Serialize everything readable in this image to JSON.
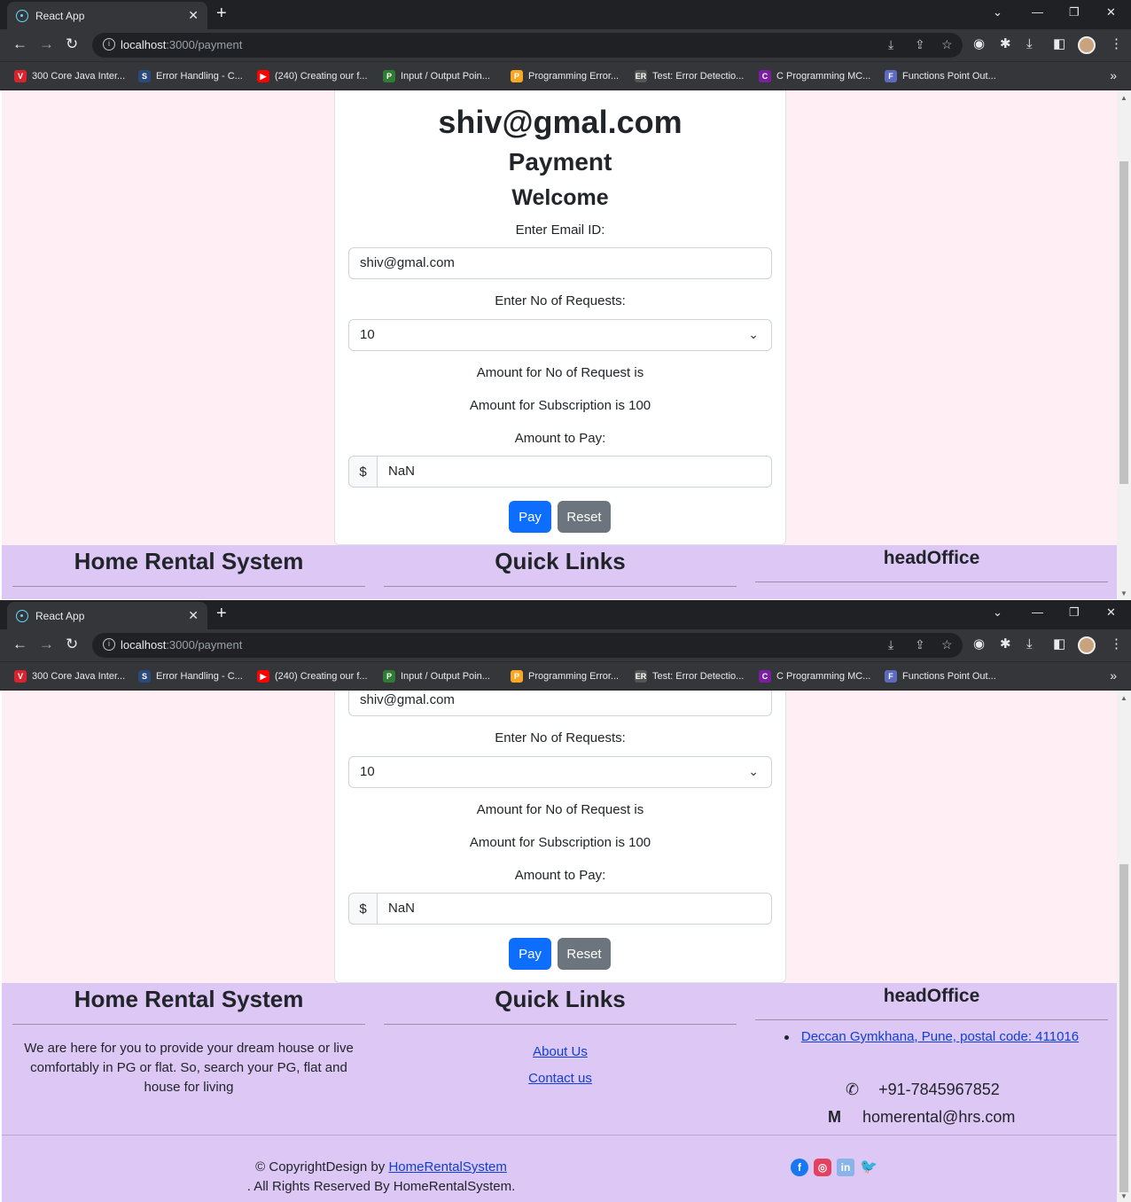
{
  "browser": {
    "tab_title": "React App",
    "url_host": "localhost",
    "url_path": ":3000/payment",
    "bookmarks": [
      "300 Core Java Inter...",
      "Error Handling - C...",
      "(240) Creating our f...",
      "Input / Output Poin...",
      "Programming Error...",
      "Test: Error Detectio...",
      "C Programming MC...",
      "Functions Point Out..."
    ]
  },
  "payment": {
    "user_email_heading": "shiv@gmal.com",
    "title": "Payment",
    "welcome": "Welcome",
    "email_label": "Enter Email ID:",
    "email_value": "shiv@gmal.com",
    "requests_label": "Enter No of Requests:",
    "requests_value": "10",
    "amount_requests_text": "Amount for No of Request is",
    "amount_subscription_text": "Amount for Subscription is 100",
    "amount_to_pay_label": "Amount to Pay:",
    "currency_symbol": "$",
    "amount_value": "NaN",
    "pay_label": "Pay",
    "reset_label": "Reset"
  },
  "footer": {
    "brand_title": "Home Rental System",
    "brand_text": "We are here for you to provide your dream house or live comfortably in PG or flat. So, search your PG, flat and house for living",
    "quicklinks_title": "Quick Links",
    "link_about": "About Us",
    "link_contact": "Contact us",
    "office_title": "headOffice",
    "office_address": "Deccan Gymkhana, Pune, postal code: 411016",
    "phone": "+91-7845967852",
    "email": "homerental@hrs.com",
    "copyright_prefix": "© CopyrightDesign by ",
    "copyright_link": "HomeRentalSystem",
    "rights": ". All Rights Reserved By HomeRentalSystem."
  },
  "colors": {
    "page_bg": "#ffeef3",
    "footer_bg": "#dcc7f5",
    "primary": "#0d6efd",
    "secondary": "#6c757d"
  }
}
